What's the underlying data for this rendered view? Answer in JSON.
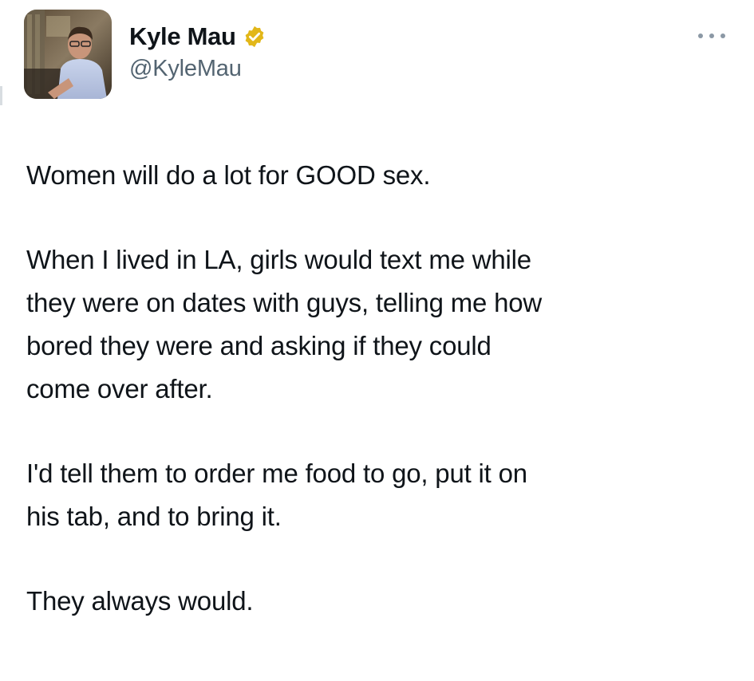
{
  "author": {
    "display_name": "Kyle Mau",
    "handle": "@KyleMau",
    "verified": true,
    "verified_badge_color": "#e2b719",
    "avatar_icon": "profile-photo"
  },
  "menu": {
    "more_icon": "more-options-icon"
  },
  "tweet": {
    "paragraphs": [
      [
        "Women will do a lot for GOOD sex."
      ],
      [
        "When I lived in LA, girls would text me while",
        "they were on dates with guys, telling me how",
        "bored they were and asking if they could",
        "come over after."
      ],
      [
        "I'd tell them to order me food to go, put it on",
        "his tab, and to bring it."
      ],
      [
        "They always would."
      ]
    ]
  },
  "colors": {
    "text": "#0f1419",
    "secondary_text": "#536471",
    "background": "#ffffff"
  }
}
